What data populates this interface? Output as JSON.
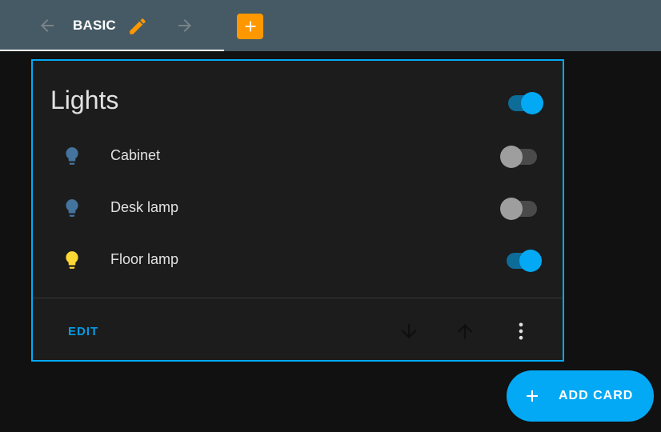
{
  "topbar": {
    "tab_label": "BASIC",
    "back_icon": "arrow-left-icon",
    "forward_icon": "arrow-right-icon",
    "edit_icon": "pencil-icon",
    "add_view_icon": "plus-icon"
  },
  "card": {
    "title": "Lights",
    "master_toggle_on": true,
    "entities": [
      {
        "name": "Cabinet",
        "icon": "lightbulb-icon",
        "state": "off",
        "icon_color": "#44739e"
      },
      {
        "name": "Desk lamp",
        "icon": "lightbulb-icon",
        "state": "off",
        "icon_color": "#44739e"
      },
      {
        "name": "Floor lamp",
        "icon": "lightbulb-icon",
        "state": "on",
        "icon_color": "#fdd835"
      }
    ],
    "actions": {
      "edit_label": "EDIT",
      "move_down_icon": "arrow-down-icon",
      "move_up_icon": "arrow-up-icon",
      "menu_icon": "dots-vertical-icon"
    }
  },
  "fab": {
    "label": "ADD CARD",
    "icon": "plus-icon"
  },
  "colors": {
    "accent": "#03a9f4",
    "header": "#455a64",
    "orange": "#ff9800",
    "card_bg": "#1c1c1c",
    "page_bg": "#111111"
  }
}
